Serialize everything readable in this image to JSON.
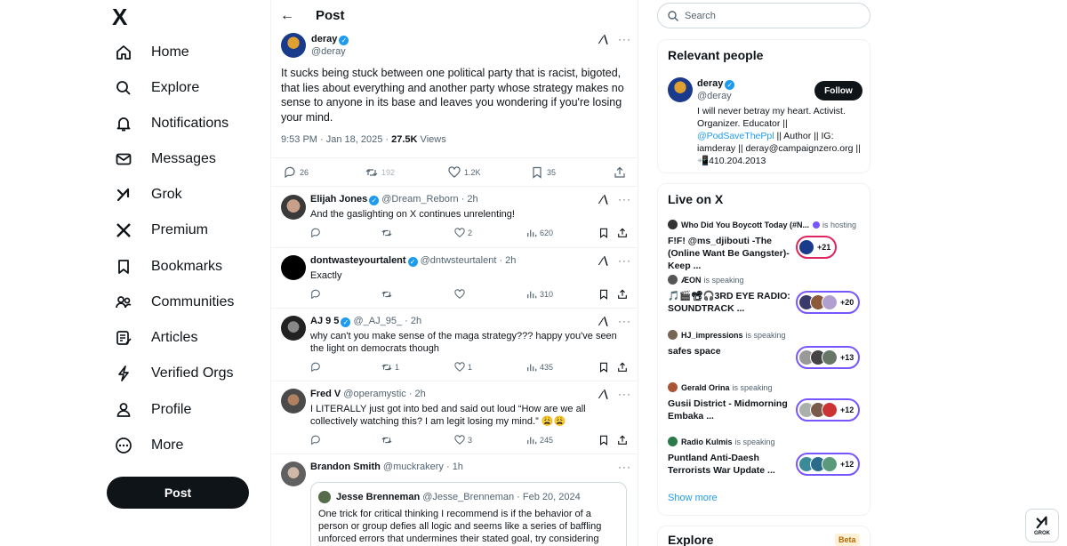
{
  "nav": {
    "logo": "X",
    "items": [
      {
        "label": "Home",
        "icon": "home-icon"
      },
      {
        "label": "Explore",
        "icon": "search-icon"
      },
      {
        "label": "Notifications",
        "icon": "bell-icon"
      },
      {
        "label": "Messages",
        "icon": "envelope-icon"
      },
      {
        "label": "Grok",
        "icon": "grok-icon"
      },
      {
        "label": "Premium",
        "icon": "x-logo-icon"
      },
      {
        "label": "Bookmarks",
        "icon": "bookmark-icon"
      },
      {
        "label": "Communities",
        "icon": "people-icon"
      },
      {
        "label": "Articles",
        "icon": "article-icon"
      },
      {
        "label": "Verified Orgs",
        "icon": "lightning-icon"
      },
      {
        "label": "Profile",
        "icon": "person-icon"
      },
      {
        "label": "More",
        "icon": "more-circle-icon"
      }
    ],
    "post_button": "Post"
  },
  "header": {
    "title": "Post"
  },
  "post": {
    "name": "deray",
    "handle": "@deray",
    "text": "It sucks being stuck between one political party that is racist, bigoted, that lies about everything and another party whose strategy makes no sense to anyone in its base and leaves you wondering if you're losing your mind.",
    "time": "9:53 PM · Jan 18, 2025 · ",
    "views": "27.5K",
    "views_label": " Views",
    "replies": "26",
    "reposts": "192",
    "likes": "1.2K",
    "bookmarks": "35"
  },
  "replies": [
    {
      "name": "Elijah Jones",
      "verified": true,
      "handle": "@Dream_Reborn · 2h",
      "text": "And the gaslighting on X continues unrelenting!",
      "reply_count": "",
      "repost_count": "",
      "like_count": "2",
      "view_count": "620"
    },
    {
      "name": "dontwasteyourtalent",
      "verified": true,
      "handle": "@dntwsteurtalent · 2h",
      "text": "Exactly",
      "reply_count": "",
      "repost_count": "",
      "like_count": "",
      "view_count": "310"
    },
    {
      "name": "AJ 9 5",
      "verified": true,
      "handle": "@_AJ_95_ · 2h",
      "text": "why can't you make sense of the maga strategy??? happy you've seen the light on democrats though",
      "reply_count": "",
      "repost_count": "1",
      "like_count": "1",
      "view_count": "435"
    },
    {
      "name": "Fred V",
      "verified": false,
      "handle": "@operamystic · 2h",
      "text": "I LITERALLY just got into bed and said out loud “How are we all collectively watching this?  I am legit losing my mind.” 😩😩",
      "reply_count": "",
      "repost_count": "",
      "like_count": "3",
      "view_count": "245"
    },
    {
      "name": "Brandon Smith",
      "verified": false,
      "handle": "@muckrakery · 1h",
      "text": ""
    }
  ],
  "quote": {
    "name": "Jesse Brenneman",
    "handle": "@Jesse_Brenneman · Feb 20, 2024",
    "text": "One trick for critical thinking I recommend is if the behavior of a person or group defies all logic and seems like a series of baffling unforced errors that undermines their stated goal, try considering whether"
  },
  "search": {
    "placeholder": "Search"
  },
  "relevant": {
    "title": "Relevant people",
    "name": "deray",
    "handle": "@deray",
    "follow": "Follow",
    "bio_1": "I will never betray my heart. Activist. Organizer. Educator || ",
    "bio_link": "@PodSaveThePpl",
    "bio_2": " || Author || IG: iamderay || deray@campaignzero.org || 📲410.204.2013"
  },
  "live": {
    "title": "Live on X",
    "spaces": [
      {
        "host": "Who Did You Boycott Today (#N...",
        "status": "is hosting",
        "title": "F!F! @ms_djibouti -The (Online Want Be Gangster)- Keep ...",
        "count": "+21",
        "color": "#e0245e"
      },
      {
        "host": "ÆON",
        "status": "is speaking",
        "title": "🎵🎬📽🎧3RD EYE RADIO: SOUNDTRACK ...",
        "count": "+20",
        "color": "#7856ff"
      },
      {
        "host": "HJ_impressions",
        "status": "is speaking",
        "title": "safes space",
        "count": "+13",
        "color": "#7856ff"
      },
      {
        "host": "Gerald Orina",
        "status": "is speaking",
        "title": "Gusii District - Midmorning Embaka ...",
        "count": "+12",
        "color": "#7856ff"
      },
      {
        "host": "Radio Kulmis",
        "status": "is speaking",
        "title": "Puntland Anti-Daesh Terrorists War Update ...",
        "count": "+12",
        "color": "#7856ff"
      }
    ],
    "show_more": "Show more"
  },
  "explore": {
    "title": "Explore",
    "badge": "Beta"
  },
  "grok_fab": {
    "label": "GROK"
  },
  "colors": {
    "accent": "#1d9bf0",
    "text": "#0f1419",
    "muted": "#536471",
    "border": "#eff3f4",
    "live": "#7856ff"
  }
}
